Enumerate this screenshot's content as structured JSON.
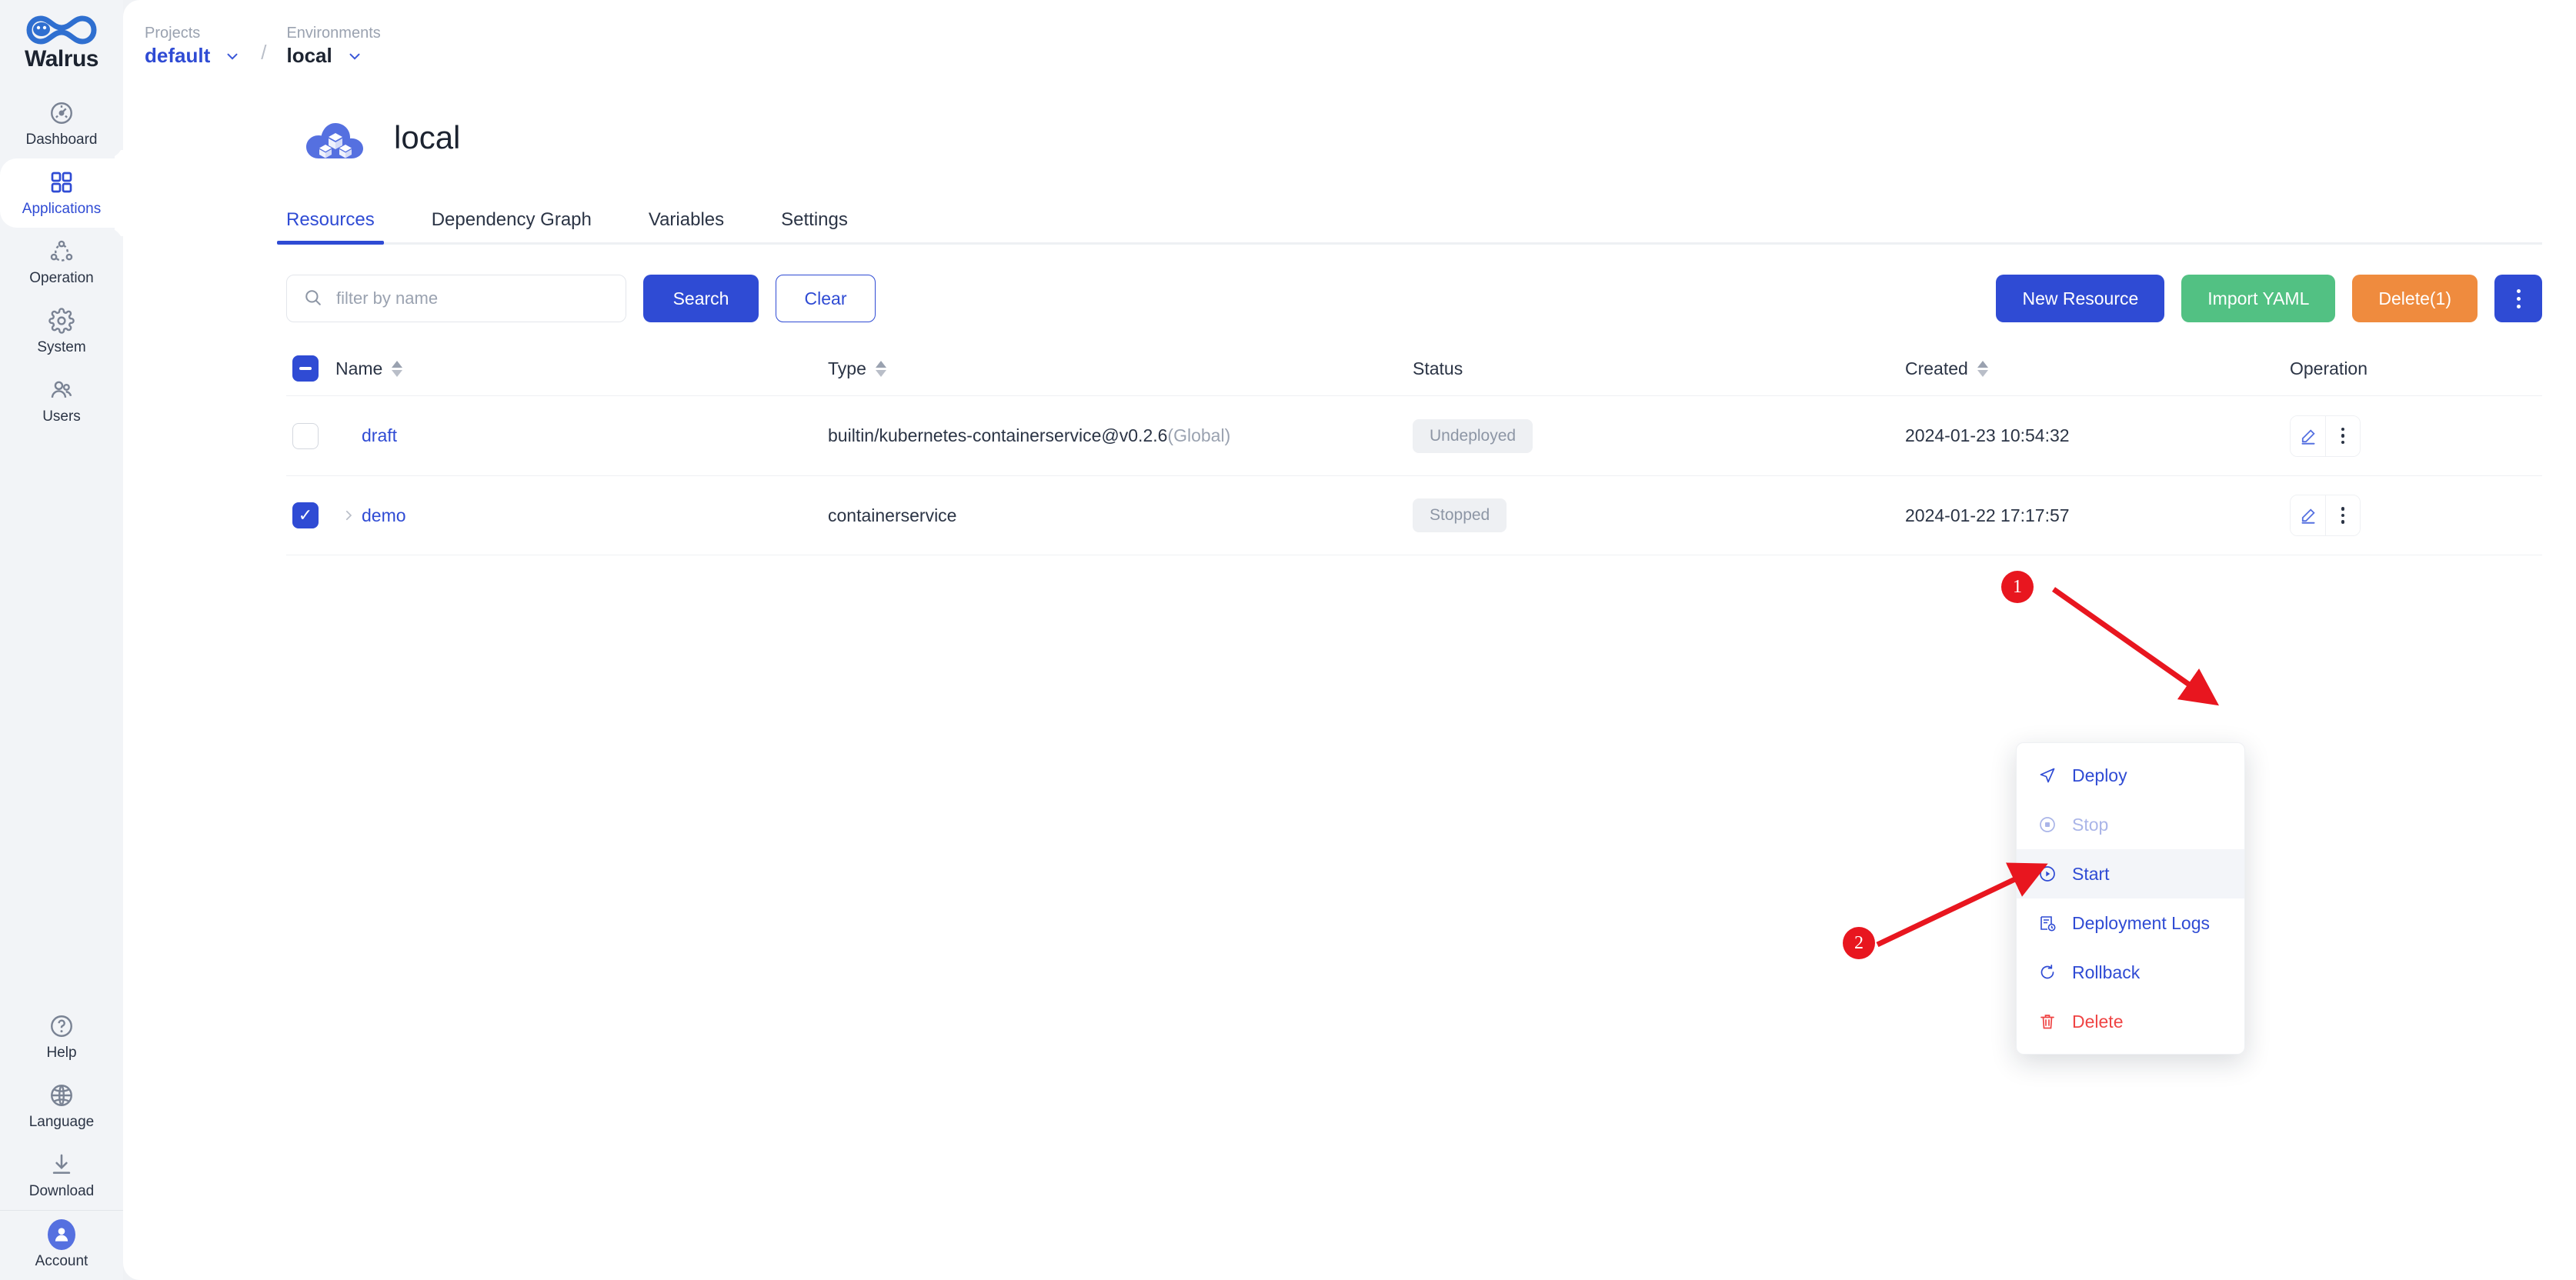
{
  "brand": {
    "name": "Walrus",
    "logo_icon": "walrus-infinity-logo"
  },
  "sidebar": {
    "items": [
      {
        "label": "Dashboard",
        "icon": "dashboard-gauge-icon",
        "active": false
      },
      {
        "label": "Applications",
        "icon": "applications-grid-icon",
        "active": true
      },
      {
        "label": "Operation",
        "icon": "operation-nodes-icon",
        "active": false
      },
      {
        "label": "System",
        "icon": "gear-icon",
        "active": false
      },
      {
        "label": "Users",
        "icon": "users-icon",
        "active": false
      }
    ],
    "bottom_items": [
      {
        "label": "Help",
        "icon": "question-circle-icon"
      },
      {
        "label": "Language",
        "icon": "globe-icon"
      },
      {
        "label": "Download",
        "icon": "download-icon"
      }
    ],
    "account": {
      "label": "Account",
      "icon": "user-avatar-icon"
    }
  },
  "breadcrumb": {
    "projects_label": "Projects",
    "project_value": "default",
    "separator": "/",
    "environments_label": "Environments",
    "environment_value": "local"
  },
  "page": {
    "title": "local",
    "icon": "environment-cloud-cubes-icon"
  },
  "tabs": [
    {
      "label": "Resources",
      "active": true
    },
    {
      "label": "Dependency Graph",
      "active": false
    },
    {
      "label": "Variables",
      "active": false
    },
    {
      "label": "Settings",
      "active": false
    }
  ],
  "toolbar": {
    "search_placeholder": "filter by name",
    "search_value": "",
    "search_button": "Search",
    "clear_button": "Clear",
    "new_resource_button": "New Resource",
    "import_yaml_button": "Import YAML",
    "delete_button": "Delete(1)",
    "more_button_icon": "vertical-dots-icon"
  },
  "table": {
    "columns": [
      {
        "key": "name",
        "label": "Name",
        "sortable": true
      },
      {
        "key": "type",
        "label": "Type",
        "sortable": true
      },
      {
        "key": "status",
        "label": "Status",
        "sortable": false
      },
      {
        "key": "created",
        "label": "Created",
        "sortable": true
      },
      {
        "key": "operation",
        "label": "Operation",
        "sortable": false
      }
    ],
    "header_checkbox_state": "indeterminate",
    "rows": [
      {
        "checked": false,
        "expandable": false,
        "name": "draft",
        "type": "builtin/kubernetes-containerservice@v0.2.6",
        "type_suffix": "(Global)",
        "status": "Undeployed",
        "created": "2024-01-23 10:54:32"
      },
      {
        "checked": true,
        "expandable": true,
        "name": "demo",
        "type": "containerservice",
        "type_suffix": "",
        "status": "Stopped",
        "created": "2024-01-22 17:17:57"
      }
    ]
  },
  "context_menu": {
    "items": [
      {
        "label": "Deploy",
        "icon": "send-plane-icon",
        "state": "normal"
      },
      {
        "label": "Stop",
        "icon": "stop-circle-icon",
        "state": "disabled"
      },
      {
        "label": "Start",
        "icon": "play-circle-icon",
        "state": "hover"
      },
      {
        "label": "Deployment Logs",
        "icon": "logs-clock-icon",
        "state": "normal"
      },
      {
        "label": "Rollback",
        "icon": "rollback-arrow-icon",
        "state": "normal"
      },
      {
        "label": "Delete",
        "icon": "trash-icon",
        "state": "danger"
      }
    ]
  },
  "annotations": [
    {
      "number": "1",
      "description": "points to the row action menu button of the demo row"
    },
    {
      "number": "2",
      "description": "points to the Start menu item"
    }
  ],
  "colors": {
    "primary": "#2f4bd4",
    "success": "#52c183",
    "warning": "#ef8b3e",
    "danger": "#ef4444",
    "annotation": "#e8161f",
    "muted": "#9aa2b0"
  }
}
